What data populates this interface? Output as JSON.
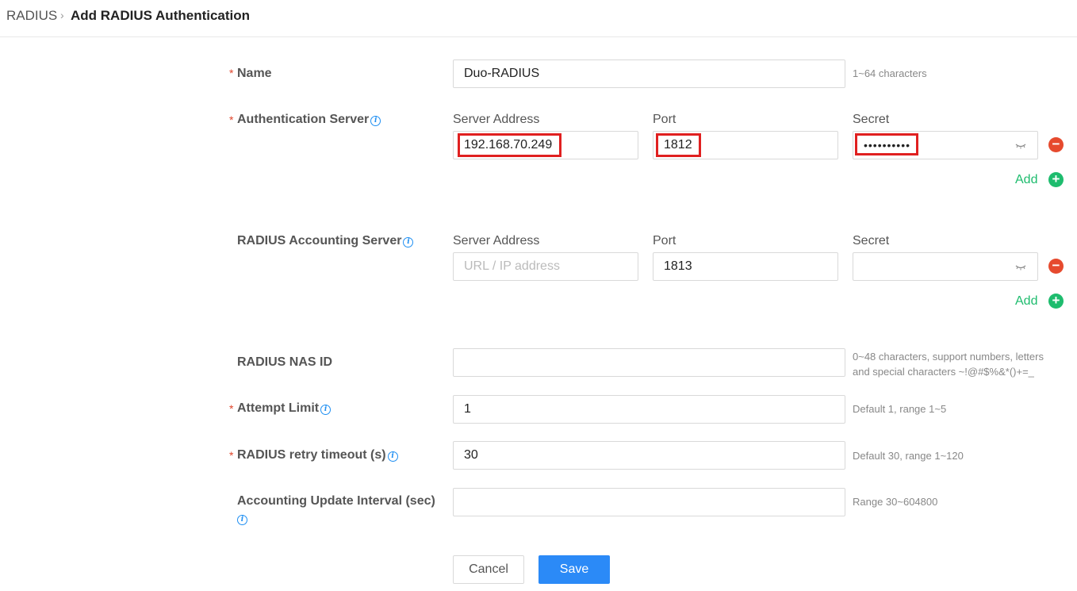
{
  "breadcrumb": {
    "root": "RADIUS",
    "separator": "›",
    "current": "Add RADIUS Authentication"
  },
  "form": {
    "name": {
      "label": "Name",
      "value": "Duo-RADIUS",
      "hint": "1~64 characters"
    },
    "auth_server": {
      "label": "Authentication Server",
      "col_address": "Server Address",
      "col_port": "Port",
      "col_secret": "Secret",
      "address": "192.168.70.249",
      "port": "1812",
      "secret": "••••••••••",
      "add_label": "Add"
    },
    "acct_server": {
      "label": "RADIUS Accounting Server",
      "col_address": "Server Address",
      "col_port": "Port",
      "col_secret": "Secret",
      "address_placeholder": "URL / IP address",
      "port": "1813",
      "secret": "",
      "add_label": "Add"
    },
    "nas_id": {
      "label": "RADIUS NAS ID",
      "value": "",
      "hint_line1": "0~48 characters, support numbers, letters",
      "hint_line2": "and special characters ~!@#$%&*()+=_"
    },
    "attempt_limit": {
      "label": "Attempt Limit",
      "value": "1",
      "hint": "Default 1, range 1~5"
    },
    "retry_timeout": {
      "label": "RADIUS retry timeout (s)",
      "value": "30",
      "hint": "Default 30, range 1~120"
    },
    "acct_interval": {
      "label": "Accounting Update Interval (sec)",
      "value": "",
      "hint": "Range 30~604800"
    }
  },
  "required_mark": "*",
  "buttons": {
    "cancel": "Cancel",
    "save": "Save"
  },
  "colors": {
    "required": "#e0452b",
    "add_green": "#1ebc6e",
    "remove_red": "#e64a2e",
    "primary": "#2b8af7",
    "highlight": "#e02020"
  }
}
